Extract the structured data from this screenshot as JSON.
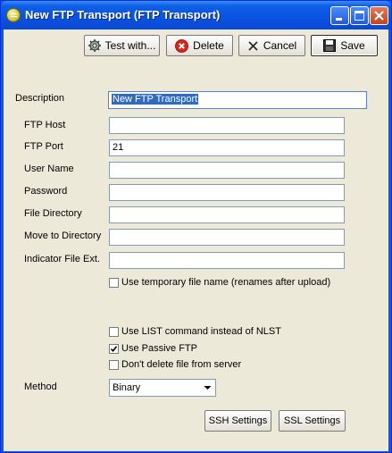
{
  "window": {
    "title": "New FTP Transport (FTP Transport)"
  },
  "toolbar": {
    "test_label": "Test with...",
    "delete_label": "Delete",
    "cancel_label": "Cancel",
    "save_label": "Save"
  },
  "form": {
    "description_label": "Description",
    "description_value": "New FTP Transport",
    "ftp_host_label": "FTP Host",
    "ftp_host_value": "",
    "ftp_port_label": "FTP Port",
    "ftp_port_value": "21",
    "user_name_label": "User Name",
    "user_name_value": "",
    "password_label": "Password",
    "password_value": "",
    "file_directory_label": "File Directory",
    "file_directory_value": "",
    "move_to_directory_label": "Move to Directory",
    "move_to_directory_value": "",
    "indicator_ext_label": "Indicator File Ext.",
    "indicator_ext_value": ""
  },
  "options": {
    "temp_file_label": "Use temporary file name (renames after upload)",
    "temp_file_checked": false,
    "list_cmd_label": "Use LIST command instead of NLST",
    "list_cmd_checked": false,
    "passive_label": "Use Passive FTP",
    "passive_checked": true,
    "no_delete_label": "Don't delete file from server",
    "no_delete_checked": false
  },
  "method": {
    "label": "Method",
    "selected": "Binary"
  },
  "buttons": {
    "ssh_label": "SSH Settings",
    "ssl_label": "SSL Settings"
  },
  "icons": {
    "app": "ftp-transport-icon",
    "test": "gear-icon",
    "delete": "delete-icon",
    "cancel": "cancel-x-icon",
    "save": "save-disk-icon"
  }
}
